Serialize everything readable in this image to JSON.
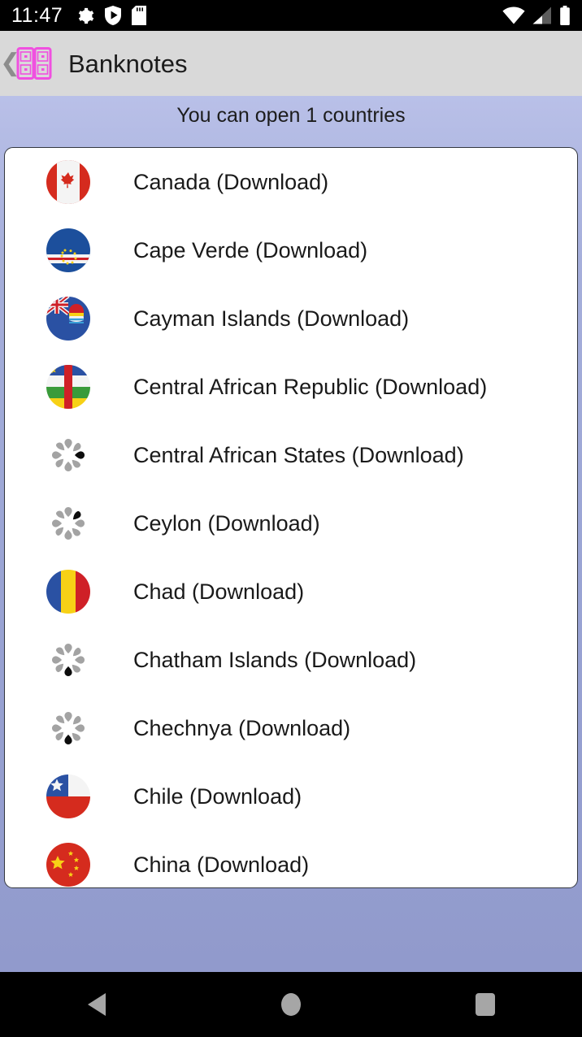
{
  "status_bar": {
    "clock": "11:47",
    "left_icons": [
      "gear-icon",
      "play-shield-icon",
      "sd-card-icon"
    ],
    "right_icons": [
      "wifi-icon",
      "cell-signal-icon",
      "battery-icon"
    ]
  },
  "action_bar": {
    "back_label": "❮",
    "app_icon": "banknotes-book-icon",
    "title": "Banknotes",
    "icon_color": "#f050e0",
    "background": "#d9d9d9"
  },
  "content": {
    "subtitle": "You can open 1 countries",
    "background_top": "#b9c0e8",
    "background_bottom": "#9099cb"
  },
  "list": {
    "rows": [
      {
        "label": "Canada (Download)",
        "icon": "flag-canada"
      },
      {
        "label": "Cape Verde (Download)",
        "icon": "flag-cape-verde"
      },
      {
        "label": "Cayman Islands (Download)",
        "icon": "flag-cayman-islands"
      },
      {
        "label": "Central African Republic (Download)",
        "icon": "flag-central-african-republic"
      },
      {
        "label": "Central African States (Download)",
        "icon": "loading-spinner"
      },
      {
        "label": "Ceylon (Download)",
        "icon": "loading-spinner"
      },
      {
        "label": "Chad (Download)",
        "icon": "flag-chad"
      },
      {
        "label": "Chatham Islands (Download)",
        "icon": "loading-spinner"
      },
      {
        "label": "Chechnya (Download)",
        "icon": "loading-spinner"
      },
      {
        "label": "Chile (Download)",
        "icon": "flag-chile"
      },
      {
        "label": "China (Download)",
        "icon": "flag-china"
      }
    ]
  },
  "nav_bar": {
    "buttons": [
      {
        "name": "back",
        "icon": "triangle-back-icon"
      },
      {
        "name": "home",
        "icon": "circle-home-icon"
      },
      {
        "name": "recents",
        "icon": "square-recents-icon"
      }
    ]
  }
}
